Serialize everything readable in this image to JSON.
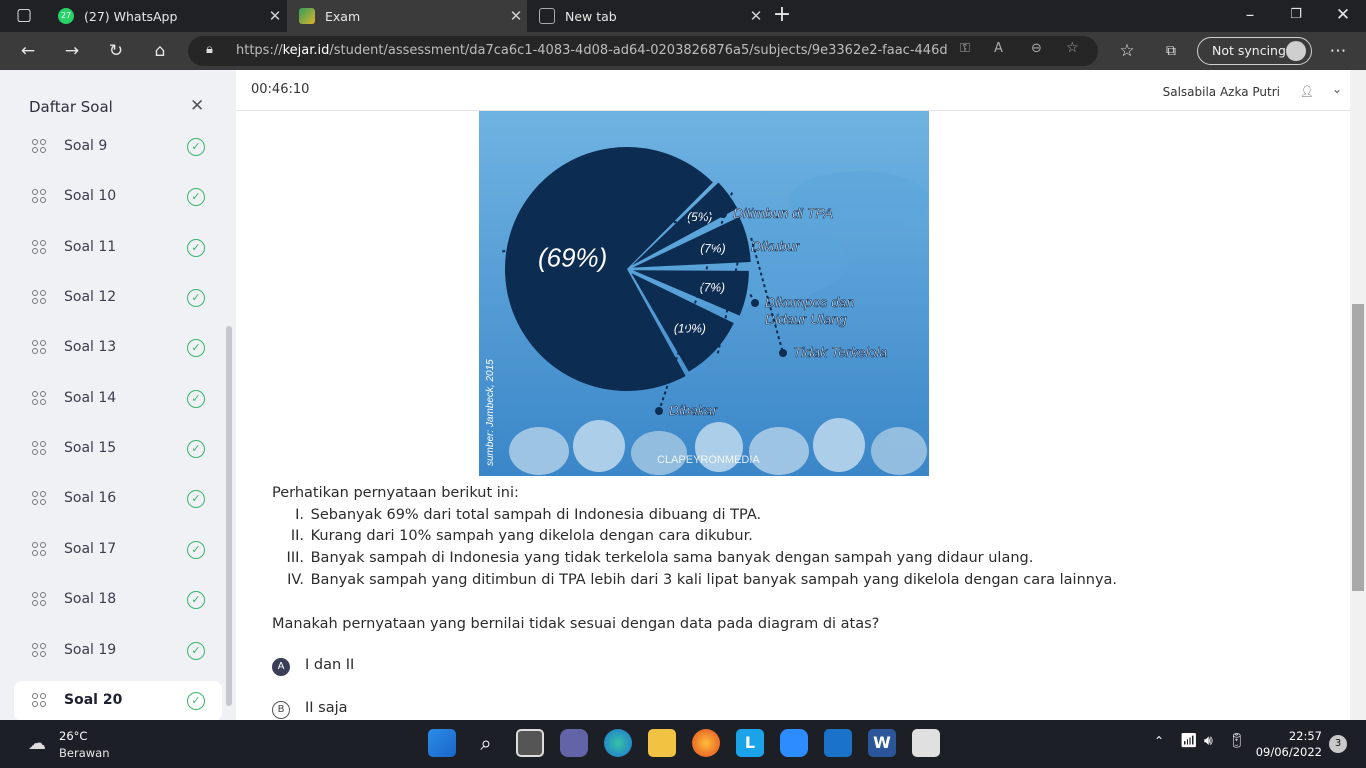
{
  "browser": {
    "tabs": [
      {
        "label": "(27) WhatsApp",
        "badge": "27",
        "active": false
      },
      {
        "label": "Exam",
        "active": true
      },
      {
        "label": "New tab",
        "active": false
      }
    ],
    "url_prefix": "https://",
    "url_domain": "kejar.id",
    "url_path": "/student/assessment/da7ca6c1-4083-4d08-ad64-0203826876a5/subjects/9e3362e2-faac-446d-954...",
    "sync_label": "Not syncing"
  },
  "sidebar": {
    "title": "Daftar Soal",
    "items": [
      {
        "label": "Soal 9"
      },
      {
        "label": "Soal 10"
      },
      {
        "label": "Soal 11"
      },
      {
        "label": "Soal 12"
      },
      {
        "label": "Soal 13"
      },
      {
        "label": "Soal 14"
      },
      {
        "label": "Soal 15"
      },
      {
        "label": "Soal 16"
      },
      {
        "label": "Soal 17"
      },
      {
        "label": "Soal 18"
      },
      {
        "label": "Soal 19"
      },
      {
        "label": "Soal 20"
      }
    ],
    "active_item": "Soal 20"
  },
  "header": {
    "timer": "00:46:10",
    "user_name": "Salsabila Azka Putri"
  },
  "chart_data": {
    "type": "pie",
    "source": "sumber: Jambeck, 2015",
    "watermark": "CLAPEYRONMEDIA",
    "slices": [
      {
        "label": "Ditimbun di TPA",
        "value": 69,
        "value_label": "(69%)"
      },
      {
        "label": "Dikubur",
        "value": 10,
        "value_label": "(10%)"
      },
      {
        "label": "Dikompos dan Didaur Ulang",
        "value": 7,
        "value_label": "(7%)"
      },
      {
        "label": "Tidak Terkelola",
        "value": 7,
        "value_label": "(7%)"
      },
      {
        "label": "Dibakar",
        "value": 5,
        "value_label": "(5%)"
      }
    ],
    "colors": {
      "bg_top": "#6fb3e2",
      "bg_bottom": "#3a86c8",
      "pie": "#0d2c52",
      "label": "#ffffff"
    }
  },
  "question": {
    "intro": "Perhatikan pernyataan berikut ini:",
    "statements": [
      {
        "num": "I.",
        "text": "Sebanyak 69% dari total sampah di Indonesia dibuang di TPA."
      },
      {
        "num": "II.",
        "text": "Kurang dari 10% sampah yang dikelola dengan cara dikubur."
      },
      {
        "num": "III.",
        "text": "Banyak sampah di Indonesia yang tidak terkelola sama banyak dengan sampah yang didaur ulang."
      },
      {
        "num": "IV.",
        "text": "Banyak sampah yang ditimbun di TPA lebih dari 3 kali lipat banyak sampah yang dikelola dengan cara lainnya."
      }
    ],
    "ask": "Manakah pernyataan yang bernilai tidak sesuai dengan data pada diagram di atas?",
    "options": [
      {
        "letter": "A",
        "text": "I dan II",
        "selected": true
      },
      {
        "letter": "B",
        "text": "II saja",
        "selected": false
      }
    ]
  },
  "taskbar": {
    "weather_temp": "26°C",
    "weather_desc": "Berawan",
    "time": "22:57",
    "date": "09/06/2022",
    "notifications": "3"
  }
}
